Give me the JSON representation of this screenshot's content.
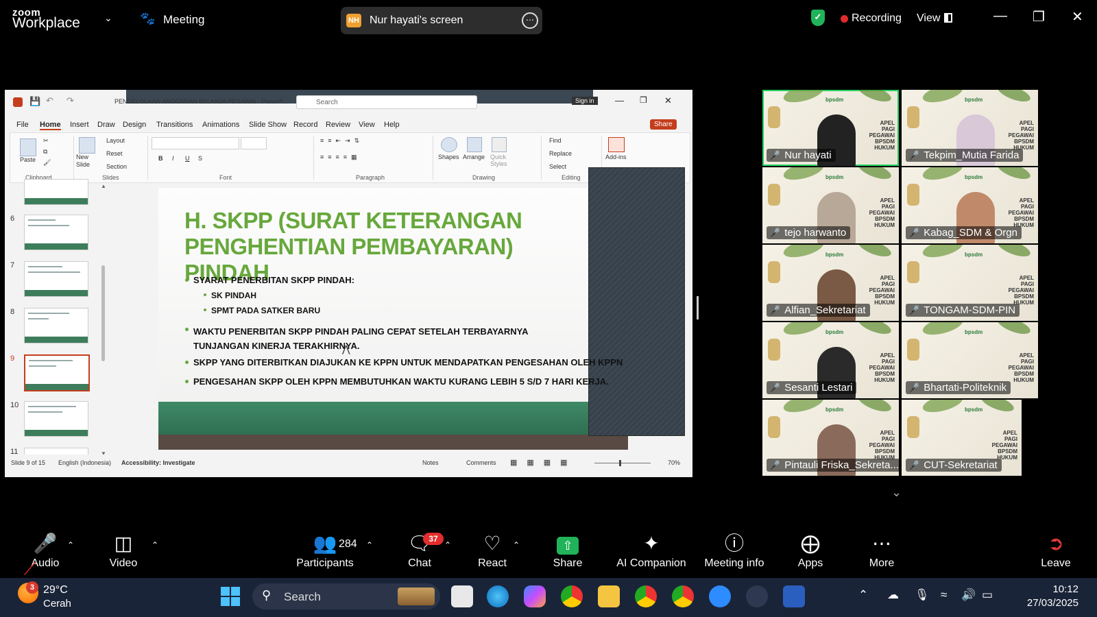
{
  "zoom": {
    "brand_top": "zoom",
    "brand_bottom": "Workplace",
    "meeting_label": "Meeting",
    "share_badge": "NH",
    "share_title": "Nur hayati's screen",
    "recording_label": "Recording",
    "view_label": "View"
  },
  "powerpoint": {
    "title": "PENGELOLAAN ANGGARAN BELANJA PEGAWAI - PowerP...",
    "search_placeholder": "Search",
    "sign_in": "Sign in",
    "tabs": [
      "File",
      "Home",
      "Insert",
      "Draw",
      "Design",
      "Transitions",
      "Animations",
      "Slide Show",
      "Record",
      "Review",
      "View",
      "Help"
    ],
    "share_button": "Share",
    "ribbon": {
      "paste": "Paste",
      "clipboard": "Clipboard",
      "new_slide": "New Slide",
      "layout": "Layout",
      "reset": "Reset",
      "section": "Section",
      "slides": "Slides",
      "font": "Font",
      "paragraph": "Paragraph",
      "shapes": "Shapes",
      "arrange": "Arrange",
      "quick_styles": "Quick Styles",
      "drawing": "Drawing",
      "find": "Find",
      "replace": "Replace",
      "select": "Select",
      "editing": "Editing",
      "addins": "Add-ins"
    },
    "thumb_numbers": [
      "6",
      "7",
      "8",
      "9",
      "10",
      "11"
    ],
    "slide": {
      "title": "H. SKPP (SURAT KETERANGAN PENGHENTIAN PEMBAYARAN) PINDAH",
      "b1": "SYARAT PENERBITAN SKPP PINDAH:",
      "b1a": "SK PINDAH",
      "b1b": "SPMT PADA SATKER BARU",
      "b2": "WAKTU PENERBITAN SKPP PINDAH PALING CEPAT SETELAH TERBAYARNYA TUNJANGAN KINERJA TERAKHIRNYA.",
      "b3": "SKPP YANG DITERBITKAN DIAJUKAN KE KPPN UNTUK MENDAPATKAN PENGESAHAN OLEH KPPN",
      "b4": "PENGESAHAN SKPP OLEH KPPN MEMBUTUHKAN WAKTU KURANG LEBIH 5 S/D 7 HARI KERJA."
    },
    "status": {
      "slide_of": "Slide 9 of 15",
      "language": "English (Indonesia)",
      "accessibility": "Accessibility: Investigate",
      "notes": "Notes",
      "comments": "Comments",
      "zoom": "70%"
    }
  },
  "participants": [
    {
      "name": "Nur hayati",
      "muted": false,
      "active": true
    },
    {
      "name": "Tekpim_Mutia Farida",
      "muted": true,
      "active": false
    },
    {
      "name": "tejo harwanto",
      "muted": true,
      "active": false
    },
    {
      "name": "Kabag_SDM & Orgn",
      "muted": true,
      "active": false
    },
    {
      "name": "Alfian_Sekretariat",
      "muted": true,
      "active": false
    },
    {
      "name": "TONGAM-SDM-PIN",
      "muted": true,
      "active": false
    },
    {
      "name": "Sesanti Lestari",
      "muted": true,
      "active": false
    },
    {
      "name": "Bhartati-Politeknik",
      "muted": true,
      "active": false
    },
    {
      "name": "Pintauli Friska_Sekreta...",
      "muted": true,
      "active": false
    },
    {
      "name": "CUT-Sekretariat",
      "muted": true,
      "active": false
    }
  ],
  "tile_texts": {
    "bpsdm": "bpsdm",
    "apel": "APEL PAGI PEGAWAI BPSDM HUKUM"
  },
  "toolbar": {
    "audio": "Audio",
    "video": "Video",
    "participants": "Participants",
    "participants_count": "284",
    "chat": "Chat",
    "chat_badge": "37",
    "react": "React",
    "share": "Share",
    "ai_companion": "AI Companion",
    "meeting_info": "Meeting info",
    "apps": "Apps",
    "more": "More",
    "leave": "Leave"
  },
  "taskbar": {
    "weather_badge": "3",
    "temp": "29°C",
    "condition": "Cerah",
    "search": "Search",
    "time": "10:12",
    "date": "27/03/2025"
  }
}
